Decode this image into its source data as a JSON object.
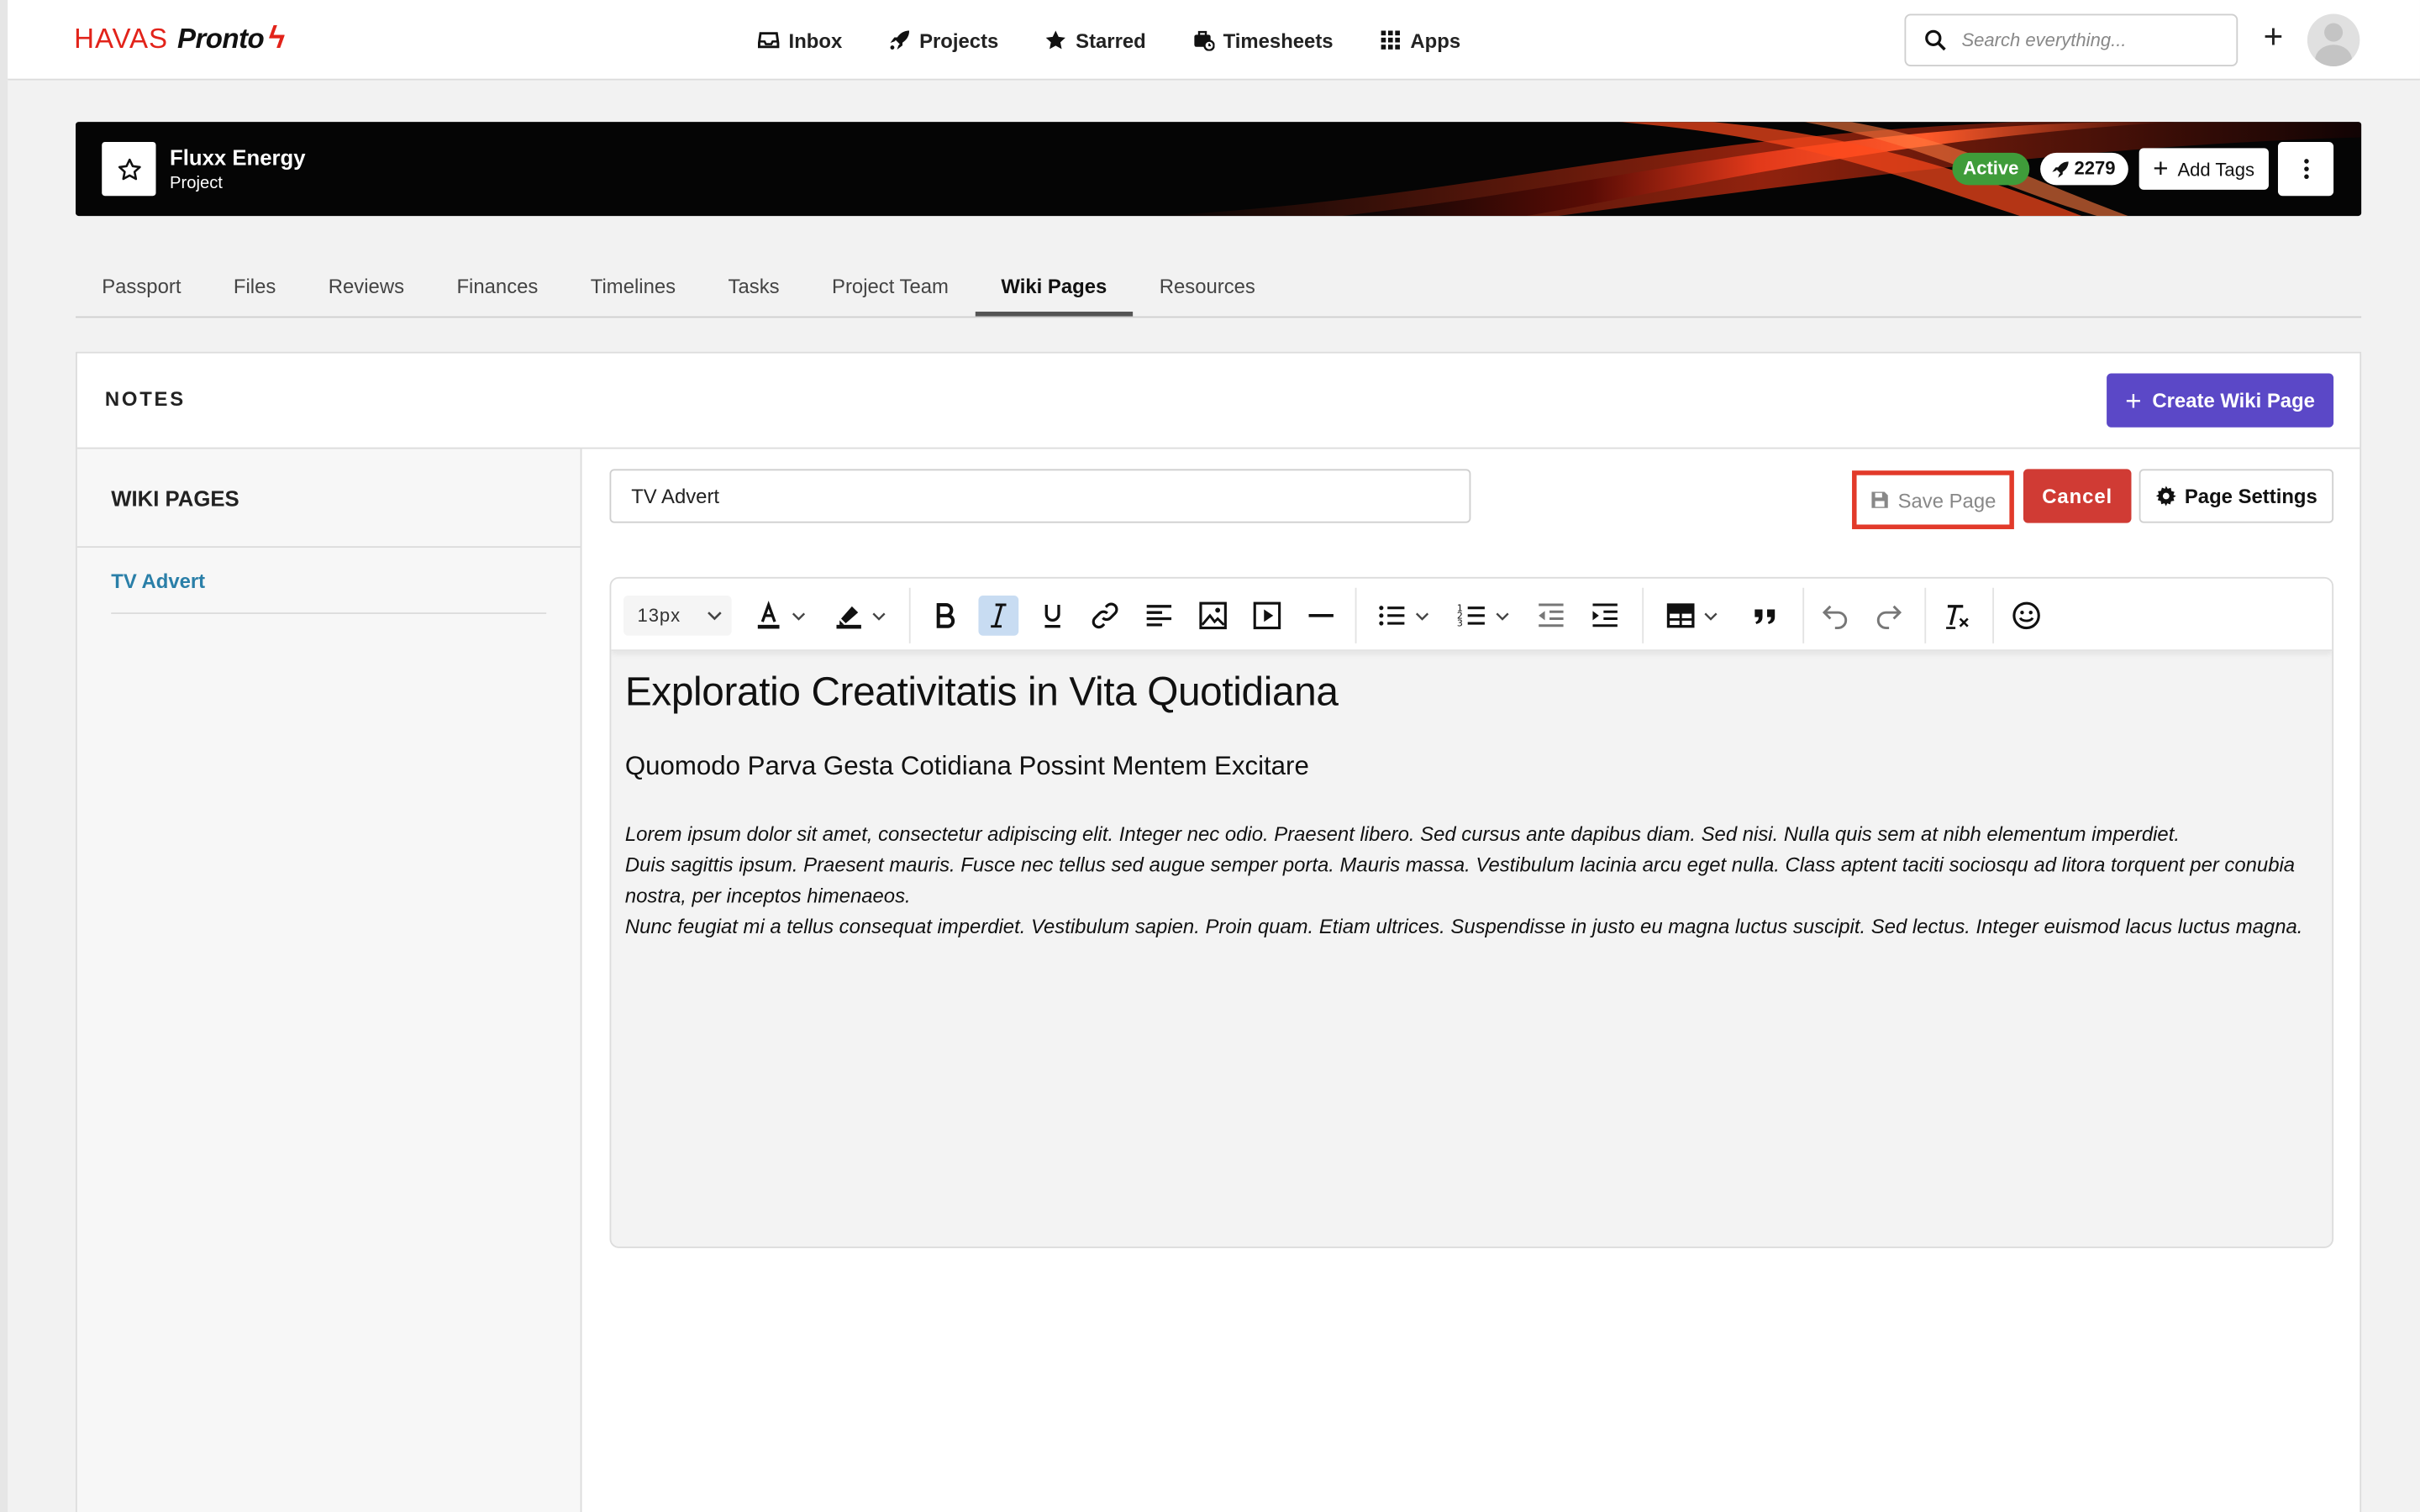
{
  "brand": {
    "name_part1": "HAVAS",
    "name_part2": "Pronto",
    "accent_color": "#e2231a"
  },
  "nav": {
    "items": [
      {
        "label": "Inbox",
        "icon": "inbox-icon"
      },
      {
        "label": "Projects",
        "icon": "rocket-icon"
      },
      {
        "label": "Starred",
        "icon": "star-icon"
      },
      {
        "label": "Timesheets",
        "icon": "timesheet-icon"
      },
      {
        "label": "Apps",
        "icon": "grid-icon"
      }
    ],
    "search_placeholder": "Search everything..."
  },
  "project": {
    "name": "Fluxx Energy",
    "type": "Project",
    "status": "Active",
    "status_color": "#3f9c3a",
    "count": "2279",
    "add_tags_label": "Add Tags"
  },
  "tabs": [
    {
      "label": "Passport"
    },
    {
      "label": "Files"
    },
    {
      "label": "Reviews"
    },
    {
      "label": "Finances"
    },
    {
      "label": "Timelines"
    },
    {
      "label": "Tasks"
    },
    {
      "label": "Project Team"
    },
    {
      "label": "Wiki Pages",
      "active": true
    },
    {
      "label": "Resources"
    }
  ],
  "notes": {
    "title": "NOTES",
    "create_label": "Create Wiki Page",
    "create_color": "#5b48c7"
  },
  "sidebar": {
    "title": "WIKI PAGES",
    "items": [
      {
        "label": "TV Advert"
      }
    ]
  },
  "editor": {
    "page_title_value": "TV Advert",
    "save_label": "Save Page",
    "cancel_label": "Cancel",
    "settings_label": "Page Settings",
    "font_size": "13px",
    "heading1": "Exploratio Creativitatis in Vita Quotidiana",
    "heading2": "Quomodo Parva Gesta Cotidiana Possint Mentem Excitare",
    "paragraphs": [
      "Lorem ipsum dolor sit amet, consectetur adipiscing elit. Integer nec odio. Praesent libero. Sed cursus ante dapibus diam. Sed nisi. Nulla quis sem at nibh elementum imperdiet.",
      "Duis sagittis ipsum. Praesent mauris. Fusce nec tellus sed augue semper porta. Mauris massa. Vestibulum lacinia arcu eget nulla. Class aptent taciti sociosqu ad litora torquent per conubia nostra, per inceptos himenaeos.",
      "Nunc feugiat mi a tellus consequat imperdiet. Vestibulum sapien. Proin quam. Etiam ultrices. Suspendisse in justo eu magna luctus suscipit. Sed lectus. Integer euismod lacus luctus magna."
    ]
  }
}
